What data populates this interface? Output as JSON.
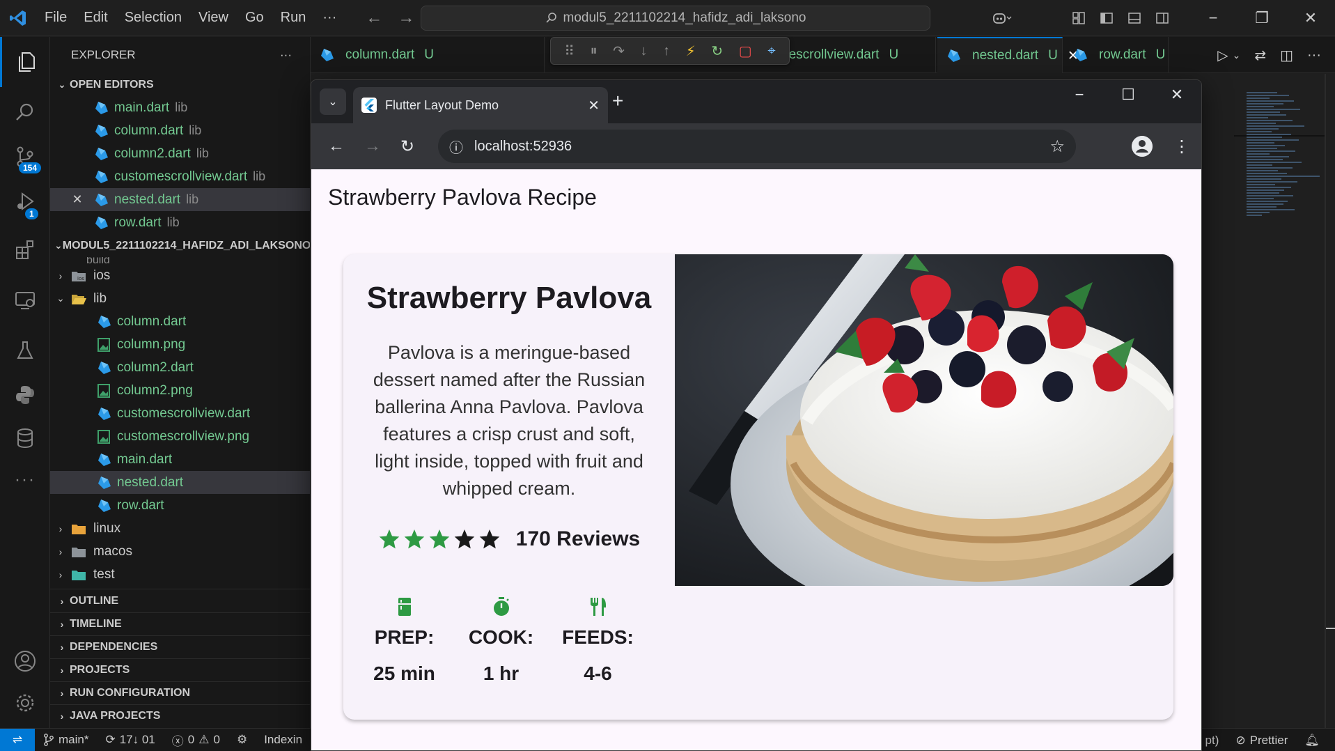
{
  "titlebar": {
    "menu": [
      "File",
      "Edit",
      "Selection",
      "View",
      "Go",
      "Run",
      "···"
    ],
    "search": "modul5_2211102214_hafidz_adi_laksono"
  },
  "activity": {
    "scm_badge": "154",
    "debug_badge": "1"
  },
  "explorer": {
    "header": "EXPLORER",
    "more": "···",
    "open_editors_title": "OPEN EDITORS",
    "open_editors": [
      {
        "name": "main.dart",
        "hint": "lib"
      },
      {
        "name": "column.dart",
        "hint": "lib"
      },
      {
        "name": "column2.dart",
        "hint": "lib"
      },
      {
        "name": "customescrollview.dart",
        "hint": "lib"
      },
      {
        "name": "nested.dart",
        "hint": "lib"
      },
      {
        "name": "row.dart",
        "hint": "lib"
      }
    ],
    "project_title": "MODUL5_2211102214_HAFIDZ_ADI_LAKSONO",
    "tree": {
      "cut_folder": "build",
      "ios": "ios",
      "lib": "lib",
      "lib_files": [
        "column.dart",
        "column.png",
        "column2.dart",
        "column2.png",
        "customescrollview.dart",
        "customescrollview.png",
        "main.dart",
        "nested.dart",
        "row.dart"
      ],
      "linux": "linux",
      "macos": "macos",
      "test": "test"
    },
    "sections": [
      "OUTLINE",
      "TIMELINE",
      "DEPENDENCIES",
      "PROJECTS",
      "RUN CONFIGURATION",
      "JAVA PROJECTS"
    ]
  },
  "tabs": [
    {
      "name": "column.dart",
      "status": "U"
    },
    {
      "name": "nescrollview.dart",
      "status": "U"
    },
    {
      "name": "nested.dart",
      "status": "U"
    },
    {
      "name": "row.dart",
      "status": "U"
    }
  ],
  "statusbar": {
    "branch": "main*",
    "sync": "17↓ 01",
    "errors": "0",
    "warnings": "0",
    "task": "Indexin",
    "right_partial": "pt)",
    "prettier": "Prettier"
  },
  "chrome": {
    "tab_title": "Flutter Layout Demo",
    "url": "localhost:52936"
  },
  "app": {
    "appbar_title": "Strawberry Pavlova Recipe",
    "card_title": "Strawberry Pavlova",
    "description": "Pavlova is a meringue-based dessert named after the Russian ballerina Anna Pavlova. Pavlova features a crisp crust and soft, light inside, topped with fruit and whipped cream.",
    "rating_stars": 3,
    "rating_max": 5,
    "reviews": "170 Reviews",
    "info": [
      {
        "icon": "kitchen-icon",
        "label": "PREP:",
        "value": "25 min"
      },
      {
        "icon": "timer-icon",
        "label": "COOK:",
        "value": "1 hr"
      },
      {
        "icon": "restaurant-icon",
        "label": "FEEDS:",
        "value": "4-6"
      }
    ],
    "colors": {
      "accent_green": "#2e9a43",
      "dark_star": "#1a1a1a"
    }
  }
}
